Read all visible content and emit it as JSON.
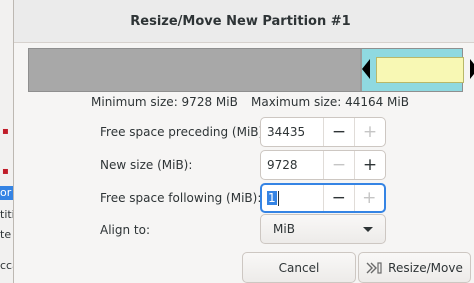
{
  "background": {
    "fragments": [
      "",
      "",
      "",
      "",
      "or",
      "titi",
      "te",
      "",
      "cca"
    ]
  },
  "dialog": {
    "title": "Resize/Move New Partition #1",
    "min_size": "Minimum size: 9728 MiB",
    "max_size": "Maximum size: 44164 MiB",
    "fields": {
      "preceding": {
        "label": "Free space preceding (MiB):",
        "value": "34435"
      },
      "new_size": {
        "label": "New size (MiB):",
        "value": "9728"
      },
      "following": {
        "label": "Free space following (MiB):",
        "value": "1"
      }
    },
    "align": {
      "label": "Align to:",
      "value": "MiB"
    },
    "buttons": {
      "cancel": "Cancel",
      "resize": "Resize/Move"
    },
    "glyphs": {
      "minus": "−",
      "plus": "+"
    }
  },
  "colors": {
    "accent": "#3584e4",
    "partition_selected": "#8fd9e0",
    "partition_fill": "#f8f8b4",
    "unallocated": "#a8a8a8"
  },
  "icons": [
    "resize-move-icon",
    "combo-arrow-icon",
    "minus-icon",
    "plus-icon"
  ]
}
